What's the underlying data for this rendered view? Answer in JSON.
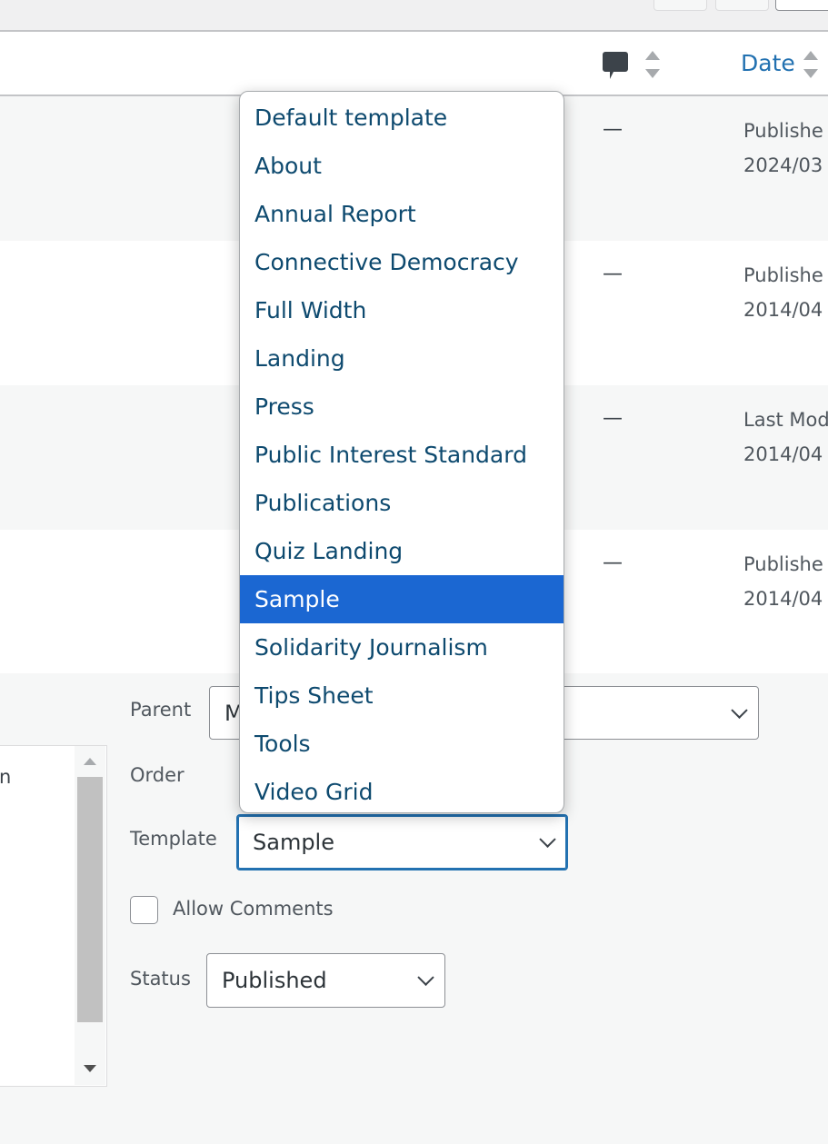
{
  "table": {
    "date_header": "Date",
    "comments_icon": "comment-bubble-icon",
    "sort_icon": "sort-arrows-icon",
    "rows": [
      {
        "comments": "—",
        "status": "Publishe",
        "date": "2024/03",
        "bg": "#f6f7f7"
      },
      {
        "comments": "—",
        "status": "Publishe",
        "date": "2014/04",
        "bg": "#ffffff"
      },
      {
        "comments": "—",
        "status": "Last Mod",
        "date": "2014/04",
        "bg": "#f6f7f7"
      },
      {
        "comments": "—",
        "status": "Publishe",
        "date": "2014/04",
        "bg": "#ffffff"
      }
    ]
  },
  "quick_edit": {
    "list_partial_text": "n",
    "parent_label": "Parent",
    "parent_value": "M",
    "order_label": "Order",
    "template_label": "Template",
    "template_value": "Sample",
    "allow_comments_label": "Allow Comments",
    "allow_comments_checked": false,
    "status_label": "Status",
    "status_value": "Published"
  },
  "template_menu": {
    "options": [
      "Default template",
      "About",
      "Annual Report",
      "Connective Democracy",
      "Full Width",
      "Landing",
      "Press",
      "Public Interest Standard",
      "Publications",
      "Quiz Landing",
      "Sample",
      "Solidarity Journalism",
      "Tips Sheet",
      "Tools",
      "Video Grid"
    ],
    "selected": "Sample",
    "highlight_color": "#1b67d2"
  },
  "colors": {
    "link": "#2271b1",
    "focus": "#2271b1"
  }
}
